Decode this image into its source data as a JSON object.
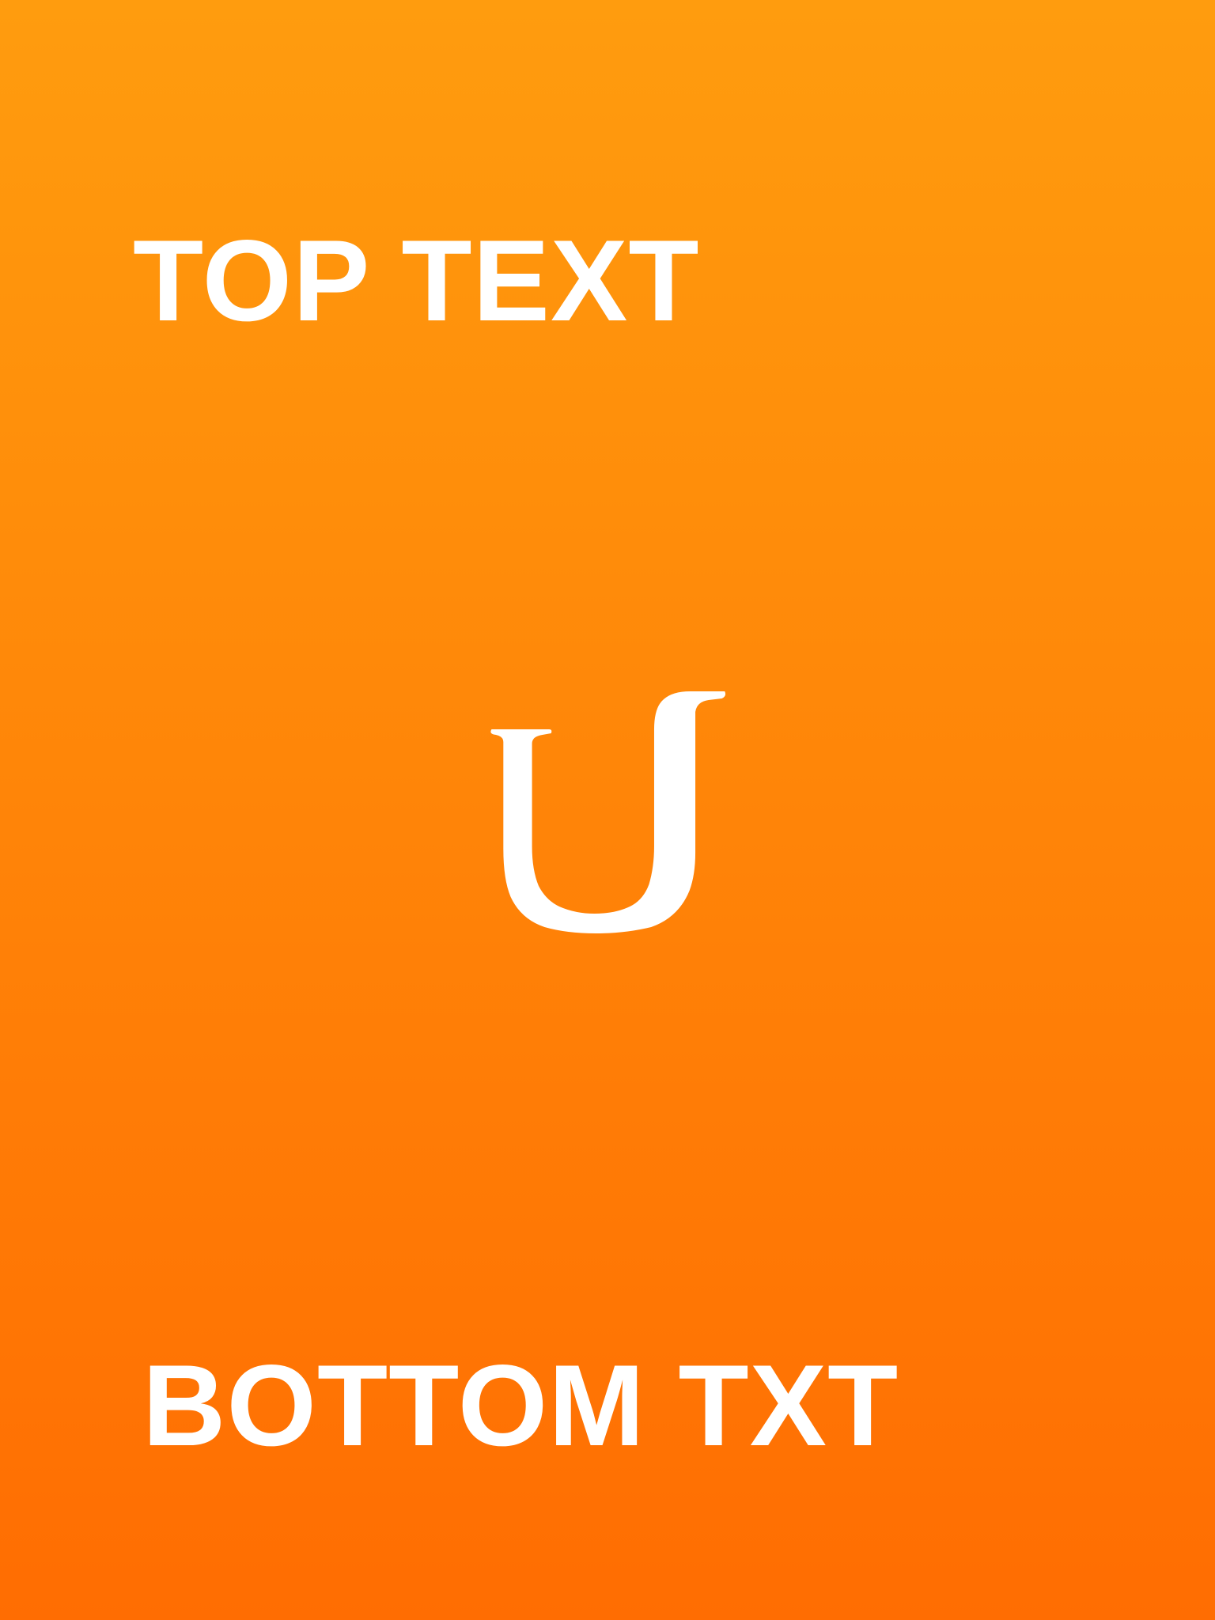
{
  "background": {
    "gradient_top": "#FF9C0E",
    "gradient_bottom": "#FF6D02"
  },
  "captions": {
    "top": "TOP TEXT",
    "bottom": "BOTTOM TXT"
  },
  "logo": {
    "icon": "stylized-letter-u-icon",
    "color": "#FFFFFF"
  }
}
